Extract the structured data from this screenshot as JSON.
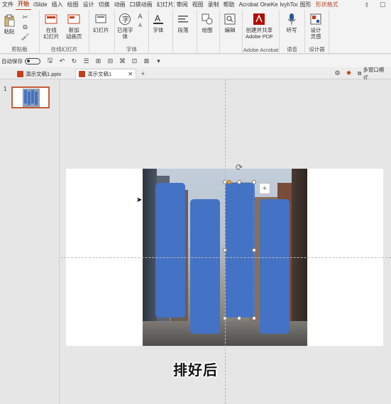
{
  "menu": {
    "tabs": [
      "文件",
      "开始",
      "iSlide",
      "插入",
      "绘图",
      "设计",
      "切换",
      "动画",
      "口袋动画",
      "幻灯片放映",
      "审阅",
      "视图",
      "录制",
      "帮助",
      "Acrobat",
      "OneKey",
      "lvyhTools",
      "图形",
      "形状格式"
    ],
    "active": "开始"
  },
  "ribbon": {
    "clipboard": {
      "paste": "粘贴",
      "group": "剪贴板"
    },
    "online": {
      "btn1": "在线\n幻灯片",
      "btn2": "新加\n动画页",
      "group": "在线幻灯片"
    },
    "slides": {
      "btn": "幻灯片"
    },
    "font": {
      "btn1": "已用字\n体",
      "btn2": "字体",
      "group": "字体"
    },
    "paragraph": {
      "btn": "段落"
    },
    "drawing": {
      "btn": "绘图"
    },
    "editing": {
      "btn": "编辑"
    },
    "acrobat": {
      "btn": "创建并共享\nAdobe PDF",
      "group": "Adobe Acrobat"
    },
    "voice": {
      "btn": "听写",
      "group": "语音"
    },
    "designer": {
      "btn": "设计\n灵感",
      "group": "设计器"
    }
  },
  "qat": {
    "autosave": "自动保存"
  },
  "filetabs": {
    "tab1": "演示文稿1.pptx",
    "tab2": "演示文稿1",
    "multiwindow": "多窗口模式"
  },
  "slides_panel": {
    "number": "1"
  },
  "caption": "排好后",
  "colors": {
    "accent": "#b7472a",
    "shape_fill": "#4472c4"
  }
}
